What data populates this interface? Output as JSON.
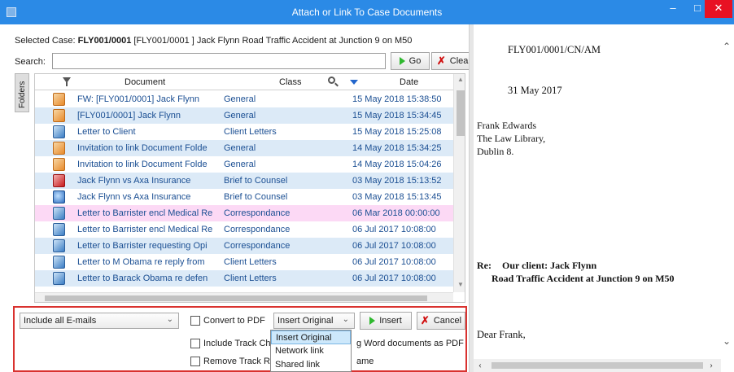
{
  "window": {
    "title": "Attach or Link To Case Documents",
    "minimize": "–",
    "maximize": "□",
    "close": "✕"
  },
  "case": {
    "label": "Selected Case:",
    "code": "FLY001/0001",
    "description": "[FLY001/0001 ] Jack Flynn Road Traffic Accident at Junction 9 on M50"
  },
  "search": {
    "label": "Search:",
    "value": "",
    "go_label": "Go",
    "clear_label": "Clear"
  },
  "folders_tab": "Folders",
  "grid": {
    "headers": {
      "document": "Document",
      "class": "Class",
      "date": "Date"
    },
    "rows": [
      {
        "icon": "email-icon",
        "document": "FW: [FLY001/0001] Jack Flynn",
        "class": "General",
        "date": "15 May 2018 15:38:50"
      },
      {
        "icon": "email-icon",
        "document": "[FLY001/0001] Jack Flynn",
        "class": "General",
        "date": "15 May 2018 15:34:45"
      },
      {
        "icon": "word-doc-icon",
        "document": "Letter to Client",
        "class": "Client Letters",
        "date": "15 May 2018 15:25:08"
      },
      {
        "icon": "email-icon",
        "document": "Invitation to link Document Folde",
        "class": "General",
        "date": "14 May 2018 15:34:25"
      },
      {
        "icon": "email-icon",
        "document": "Invitation to link Document Folde",
        "class": "General",
        "date": "14 May 2018 15:04:26"
      },
      {
        "icon": "pdf-icon",
        "document": "Jack Flynn vs Axa Insurance",
        "class": "Brief to Counsel",
        "date": "03 May 2018 15:13:52"
      },
      {
        "icon": "link-icon",
        "document": "Jack Flynn vs Axa Insurance",
        "class": "Brief to Counsel",
        "date": "03 May 2018 15:13:45"
      },
      {
        "icon": "word-doc-icon",
        "document": "Letter to Barrister encl Medical Re",
        "class": "Correspondance",
        "date": "06 Mar 2018 00:00:00"
      },
      {
        "icon": "word-doc-icon",
        "document": "Letter to Barrister encl Medical Re",
        "class": "Correspondance",
        "date": "06 Jul 2017 10:08:00"
      },
      {
        "icon": "word-doc-icon",
        "document": "Letter to Barrister requesting Opi",
        "class": "Correspondance",
        "date": "06 Jul 2017 10:08:00"
      },
      {
        "icon": "word-doc-icon",
        "document": "Letter to M Obama re reply from",
        "class": "Client Letters",
        "date": "06 Jul 2017 10:08:00"
      },
      {
        "icon": "word-doc-icon",
        "document": "Letter to Barack Obama re defen",
        "class": "Client Letters",
        "date": "06 Jul 2017 10:08:00"
      }
    ]
  },
  "options": {
    "email_filter": "Include all E-mails",
    "convert_pdf": "Convert to PDF",
    "insert_mode": "Insert Original",
    "insert_label": "Insert",
    "cancel_label": "Cancel",
    "include_track": "Include Track Ch",
    "word_as_pdf": "g Word documents as PDF",
    "remove_track": "Remove Track Re",
    "name_suffix": "ame",
    "dropdown_options": [
      "Insert Original",
      "Network link",
      "Shared link"
    ]
  },
  "preview": {
    "reference": "FLY001/0001/CN/AM",
    "date": "31 May 2017",
    "address": [
      "Frank Edwards",
      "The Law Library,",
      "Dublin 8."
    ],
    "re_label": "Re:",
    "re_line1": "Our client: Jack Flynn",
    "re_line2": "Road Traffic Accident at Junction 9 on M50",
    "greeting": "Dear Frank,"
  },
  "colors": {
    "titlebar": "#2b8ae6",
    "close": "#e81123",
    "row_alt": "#dceaf7",
    "row_selected": "#fcd9f5",
    "options_border": "#d9322f",
    "link_text": "#1b4f93"
  }
}
